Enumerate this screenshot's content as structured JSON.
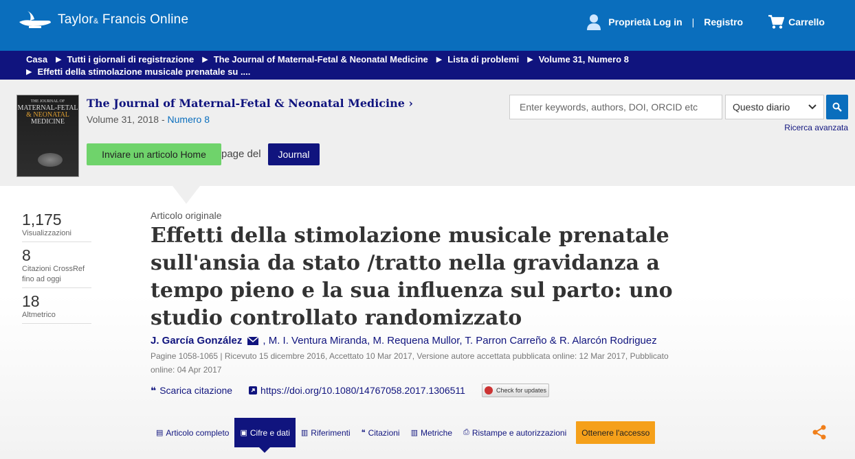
{
  "brand": {
    "name_part1": "Taylor",
    "amp": "&",
    "name_part2": " Francis Online"
  },
  "top_nav": {
    "login_label": "Proprietà Log in",
    "register_label": "Registro",
    "cart_label": "Carrello"
  },
  "breadcrumb": [
    "Casa",
    "Tutti i giornali di registrazione",
    "The Journal of Maternal-Fetal & Neonatal Medicine",
    "Lista di problemi",
    "Volume 31, Numero 8",
    "Effetti della stimolazione musicale prenatale su ...."
  ],
  "journal": {
    "cover_line1": "THE JOURNAL OF",
    "cover_line2": "MATERNAL-FETAL",
    "cover_line3": "& NEONATAL",
    "cover_line4": "MEDICINE",
    "title": "The Journal of Maternal-Fetal & Neonatal Medicine",
    "title_chevron": "›",
    "volume_text": "Volume 31, 2018 - ",
    "issue_link": "Numero 8",
    "submit_button": "Inviare un articolo Home",
    "page_of": "page del",
    "journal_button": "Journal"
  },
  "search": {
    "placeholder": "Enter keywords, authors, DOI, ORCID etc",
    "scope": "Questo diario",
    "advanced": "Ricerca avanzata"
  },
  "metrics": [
    {
      "value": "1,175",
      "label": "Visualizzazioni"
    },
    {
      "value": "8",
      "label": "Citazioni CrossRef fino ad oggi"
    },
    {
      "value": "18",
      "label": "Altmetrico"
    }
  ],
  "article": {
    "type": "Articolo originale",
    "title": "Effetti della stimolazione musicale prenatale sull'ansia da stato /tratto nella gravidanza a tempo pieno e la sua influenza sul parto: uno studio controllato randomizzato",
    "first_author": "J. García González",
    "other_authors": ", M. I. Ventura Miranda, M. Requena Mullor, T. Parron Carreño & R. Alarcón Rodriguez",
    "pub_info": "Pagine 1058-1065 | Ricevuto 15 dicembre 2016, Accettato 10 Mar 2017, Versione autore accettata pubblicata online: 12 Mar 2017, Pubblicato online: 04 Apr 2017",
    "download_citation": "Scarica citazione",
    "doi": "https://doi.org/10.1080/14767058.2017.1306511",
    "check_updates": "Check for updates"
  },
  "tabs": [
    {
      "label": "Articolo completo",
      "icon": "document-icon"
    },
    {
      "label": "Cifre e dati",
      "icon": "image-icon"
    },
    {
      "label": "Riferimenti",
      "icon": "book-icon"
    },
    {
      "label": "Citazioni",
      "icon": "quote-icon"
    },
    {
      "label": "Metriche",
      "icon": "bar-chart-icon"
    },
    {
      "label": "Ristampe e autorizzazioni",
      "icon": "print-icon"
    }
  ],
  "access_button": "Ottenere l'accesso",
  "colors": {
    "topbar": "#0a6ebd",
    "breadcrumb": "#10147e",
    "submit": "#6fd36b",
    "access": "#f5a01a",
    "share": "#f07f1a"
  }
}
